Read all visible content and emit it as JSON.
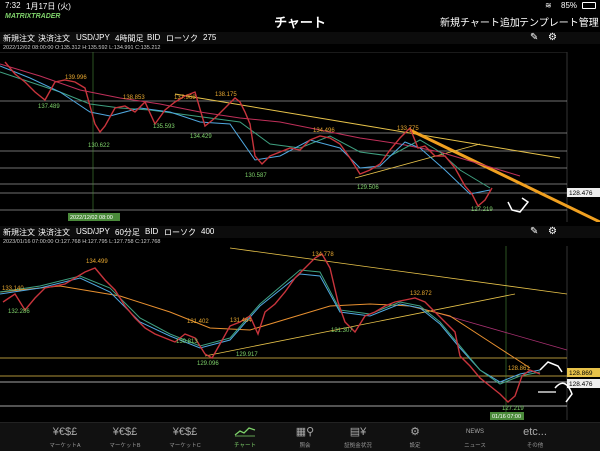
{
  "status": {
    "time": "7:32",
    "date": "1月17日 (火)",
    "battery": "85%"
  },
  "app": {
    "logo": "MATRIXTRADER",
    "title": "チャート",
    "add_chart": "新規チャート追加",
    "template": "テンプレート管理"
  },
  "top": {
    "new_order": "新規注文",
    "close_order": "決済注文",
    "pair": "USD/JPY",
    "timeframe": "4時間足",
    "price_type": "BID",
    "chart_type": "ローソク",
    "bars": "275",
    "info": "2022/12/02 08:00:00  O:135.312  H:135.592  L:134.991  C:135.212",
    "labels": [
      "139.996",
      "137.489",
      "138.853",
      "137.968",
      "138.175",
      "135.593",
      "134.429",
      "130.622",
      "134.496",
      "133.775",
      "130.587",
      "129.506",
      "127.219"
    ],
    "price_tag": "128.476",
    "cursor_date": "2022/12/02 08:00"
  },
  "bottom": {
    "new_order": "新規注文",
    "close_order": "決済注文",
    "pair": "USD/JPY",
    "timeframe": "60分足",
    "price_type": "BID",
    "chart_type": "ローソク",
    "bars": "400",
    "info": "2023/01/16 07:00:00  O:127.768  H:127.795  L:127.758  C:127.768",
    "labels": [
      "134.499",
      "133.140",
      "132.286",
      "134.778",
      "132.872",
      "131.402",
      "131.464",
      "130.813",
      "131.307",
      "129.917",
      "129.096",
      "128.861",
      "127.219"
    ],
    "price_tag_1": "128.869",
    "price_tag_2": "128.476",
    "cursor_date": "01/16 07:00"
  },
  "tabs": [
    {
      "label": "マーケットA",
      "icon": "¥€$£"
    },
    {
      "label": "マーケットB",
      "icon": "¥€$£"
    },
    {
      "label": "マーケットC",
      "icon": "¥€$£"
    },
    {
      "label": "チャート",
      "icon": "chart-icon"
    },
    {
      "label": "照会",
      "icon": "search-icon"
    },
    {
      "label": "証拠金状況",
      "icon": "yen-icon"
    },
    {
      "label": "設定",
      "icon": "gear-icon"
    },
    {
      "label": "ニュース",
      "icon": "NEWS"
    },
    {
      "label": "その他",
      "icon": "etc..."
    }
  ]
}
